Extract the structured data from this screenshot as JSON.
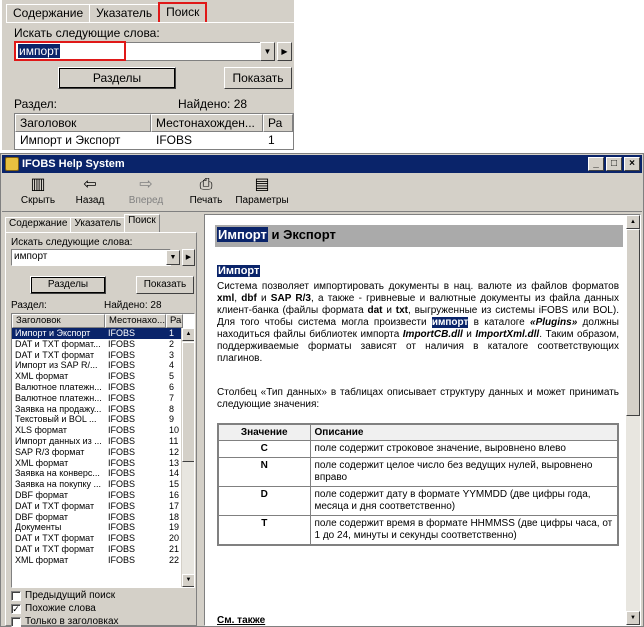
{
  "inset": {
    "tabs": [
      "Содержание",
      "Указатель",
      "Поиск"
    ],
    "search_label": "Искать следующие слова:",
    "search_value": "импорт",
    "sections_button": "Разделы",
    "show_button": "Показать",
    "section_label": "Раздел:",
    "found_label": "Найдено: 28",
    "columns": [
      "Заголовок",
      "Местонахожден...",
      "Ра"
    ],
    "first_row": [
      "Импорт и Экспорт",
      "IFOBS",
      "1"
    ]
  },
  "window": {
    "title": "IFOBS Help System",
    "controls": [
      "_",
      "□",
      "×"
    ],
    "toolbar": [
      {
        "label": "Скрыть",
        "icon": "hide-icon",
        "glyph": "▥",
        "enabled": true
      },
      {
        "label": "Назад",
        "icon": "back-icon",
        "glyph": "⇦",
        "enabled": true
      },
      {
        "label": "Вперед",
        "icon": "forward-icon",
        "glyph": "⇨",
        "enabled": false
      },
      {
        "label": "Печать",
        "icon": "print-icon",
        "glyph": "⎙",
        "enabled": true
      },
      {
        "label": "Параметры",
        "icon": "options-icon",
        "glyph": "▤",
        "enabled": true
      }
    ]
  },
  "left": {
    "tabs": [
      "Содержание",
      "Указатель",
      "Поиск"
    ],
    "search_label": "Искать следующие слова:",
    "search_value": "импорт",
    "sections_button": "Разделы",
    "show_button": "Показать",
    "section_label": "Раздел:",
    "found_label": "Найдено: 28",
    "columns": [
      "Заголовок",
      "Местонахо...",
      "Ра"
    ],
    "rows": [
      [
        "Импорт и Экспорт",
        "IFOBS",
        "1"
      ],
      [
        "DAT и TXT формат...",
        "IFOBS",
        "2"
      ],
      [
        "DAT и TXT формат",
        "IFOBS",
        "3"
      ],
      [
        "Импорт из SAP R/...",
        "IFOBS",
        "4"
      ],
      [
        "XML формат",
        "IFOBS",
        "5"
      ],
      [
        "Валютное платежн...",
        "IFOBS",
        "6"
      ],
      [
        "Валютное платежн...",
        "IFOBS",
        "7"
      ],
      [
        "Заявка на продажу...",
        "IFOBS",
        "8"
      ],
      [
        "Текстовый и BOL ...",
        "IFOBS",
        "9"
      ],
      [
        "XLS формат",
        "IFOBS",
        "10"
      ],
      [
        "Импорт данных из ...",
        "IFOBS",
        "11"
      ],
      [
        "SAP R/3 формат",
        "IFOBS",
        "12"
      ],
      [
        "XML формат",
        "IFOBS",
        "13"
      ],
      [
        "Заявка на конверс...",
        "IFOBS",
        "14"
      ],
      [
        "Заявка на покупку ...",
        "IFOBS",
        "15"
      ],
      [
        "DBF формат",
        "IFOBS",
        "16"
      ],
      [
        "DAT и TXT формат",
        "IFOBS",
        "17"
      ],
      [
        "DBF формат",
        "IFOBS",
        "18"
      ],
      [
        "Документы",
        "IFOBS",
        "19"
      ],
      [
        "DAT и TXT формат",
        "IFOBS",
        "20"
      ],
      [
        "DAT и TXT формат",
        "IFOBS",
        "21"
      ],
      [
        "XML формат",
        "IFOBS",
        "22"
      ]
    ],
    "checkboxes": [
      {
        "label": "Предыдущий поиск",
        "checked": false
      },
      {
        "label": "Похожие слова",
        "checked": true
      },
      {
        "label": "Только в заголовках",
        "checked": false
      }
    ]
  },
  "content": {
    "title_highlight": "Импорт",
    "title_rest": " и Экспорт",
    "subheading": "Импорт",
    "para1": [
      {
        "t": "Система позволяет импортировать документы в нац. валюте из файлов форматов "
      },
      {
        "t": "xml",
        "b": true
      },
      {
        "t": ", "
      },
      {
        "t": "dbf",
        "b": true
      },
      {
        "t": " и "
      },
      {
        "t": "SAP R/3",
        "b": true
      },
      {
        "t": ", а также - гривневые и валютные документы из файла данных клиент-банка (файлы формата "
      },
      {
        "t": "dat",
        "b": true
      },
      {
        "t": " и "
      },
      {
        "t": "txt",
        "b": true
      },
      {
        "t": ", выгруженные из системы iFOBS или BOL). Для того чтобы система могла произвести "
      },
      {
        "t": "импорт",
        "hl": true
      },
      {
        "t": " в каталоге "
      },
      {
        "t": "«Plugins»",
        "b": true,
        "i": true
      },
      {
        "t": " должны находиться файлы библиотек импорта "
      },
      {
        "t": "ImportCB.dll",
        "b": true,
        "i": true
      },
      {
        "t": " и "
      },
      {
        "t": "ImportXml.dll",
        "b": true,
        "i": true
      },
      {
        "t": ". Таким образом, поддерживаемые форматы зависят от наличия в каталоге соответствующих плагинов."
      }
    ],
    "para2": "Столбец «Тип данных» в таблицах описывает структуру данных и может принимать следующие значения:",
    "table_headers": [
      "Значение",
      "Описание"
    ],
    "table_rows": [
      [
        "C",
        "поле содержит строковое значение, выровнено влево"
      ],
      [
        "N",
        "поле содержит целое число без ведущих нулей, выровнено вправо"
      ],
      [
        "D",
        "поле содержит дату в формате YYMMDD (две цифры года, месяца и дня соответственно)"
      ],
      [
        "T",
        "поле содержит время в формате HHMMSS (две цифры часа, от 1 до 24, минуты и секунды соответственно)"
      ]
    ],
    "see_also": "См. также"
  }
}
